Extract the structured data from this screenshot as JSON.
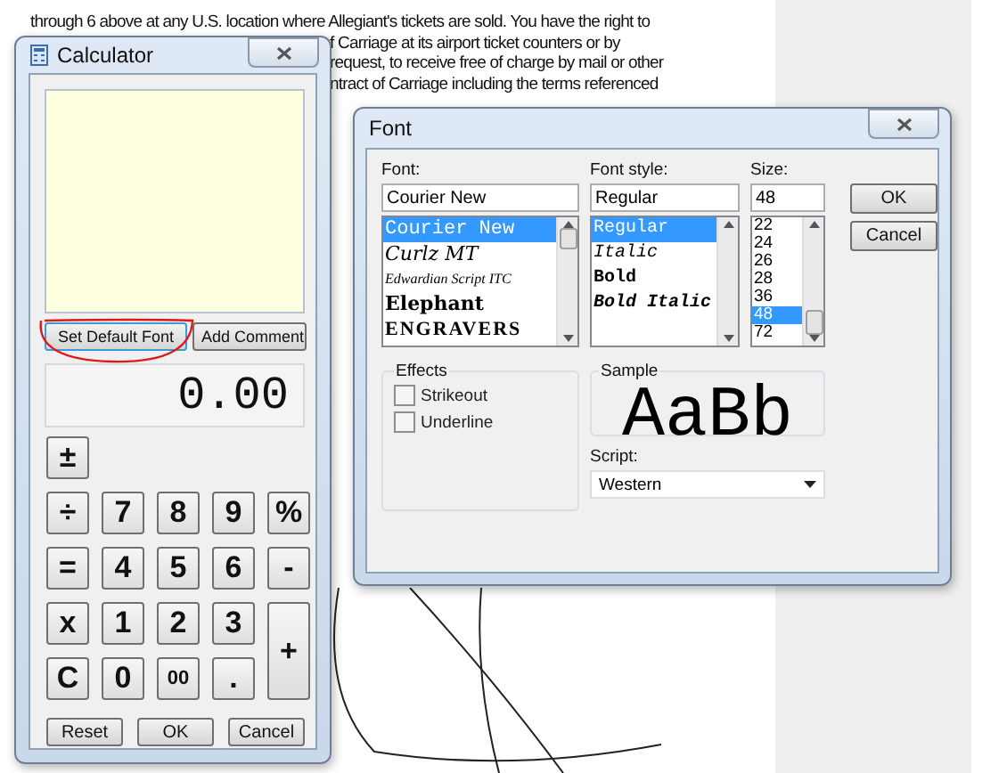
{
  "document": {
    "lines": [
      "through 6 above at any U.S. location where Allegiant's tickets are sold. You have the right to",
      "f Carriage at its airport ticket counters or by",
      "request, to receive free of charge by mail or other",
      "ntract of Carriage including the terms referenced"
    ]
  },
  "calculator": {
    "title": "Calculator",
    "note_buttons": [
      {
        "label": "Set Default Font",
        "circled": true
      },
      {
        "label": "Add Comment",
        "circled": false
      }
    ],
    "display": "0.00",
    "keys": [
      [
        {
          "label": "±",
          "kind": "normal"
        }
      ],
      [
        {
          "label": "÷",
          "kind": "normal"
        },
        {
          "label": "7",
          "kind": "normal"
        },
        {
          "label": "8",
          "kind": "normal"
        },
        {
          "label": "9",
          "kind": "normal"
        },
        {
          "label": "%",
          "kind": "normal"
        }
      ],
      [
        {
          "label": "=",
          "kind": "normal"
        },
        {
          "label": "4",
          "kind": "normal"
        },
        {
          "label": "5",
          "kind": "normal"
        },
        {
          "label": "6",
          "kind": "normal"
        },
        {
          "label": "-",
          "kind": "normal"
        }
      ],
      [
        {
          "label": "x",
          "kind": "normal"
        },
        {
          "label": "1",
          "kind": "normal"
        },
        {
          "label": "2",
          "kind": "normal"
        },
        {
          "label": "3",
          "kind": "normal"
        },
        {
          "label": "+",
          "kind": "tall"
        }
      ],
      [
        {
          "label": "C",
          "kind": "normal"
        },
        {
          "label": "0",
          "kind": "normal"
        },
        {
          "label": "00",
          "kind": "small"
        },
        {
          "label": ".",
          "kind": "normal"
        }
      ]
    ],
    "footer_buttons": [
      "Reset",
      "OK",
      "Cancel"
    ]
  },
  "font_dialog": {
    "title": "Font",
    "font": {
      "label": "Font:",
      "value": "Courier New",
      "items": [
        {
          "label": "Courier New",
          "kind": "mono",
          "selected": true
        },
        {
          "label": "Curlz MT",
          "kind": "curly",
          "selected": false
        },
        {
          "label": "Edwardian Script ITC",
          "kind": "script",
          "selected": false
        },
        {
          "label": "Elephant",
          "kind": "heavy",
          "selected": false
        },
        {
          "label": "ENGRAVERS",
          "kind": "engraved",
          "selected": false
        }
      ]
    },
    "style": {
      "label": "Font style:",
      "value": "Regular",
      "items": [
        {
          "label": "Regular",
          "kind": "regular",
          "selected": true
        },
        {
          "label": "Italic",
          "kind": "italic",
          "selected": false
        },
        {
          "label": "Bold",
          "kind": "bold",
          "selected": false
        },
        {
          "label": "Bold Italic",
          "kind": "bolditalic",
          "selected": false
        }
      ]
    },
    "size": {
      "label": "Size:",
      "value": "48",
      "items": [
        {
          "label": "22",
          "selected": false
        },
        {
          "label": "24",
          "selected": false
        },
        {
          "label": "26",
          "selected": false
        },
        {
          "label": "28",
          "selected": false
        },
        {
          "label": "36",
          "selected": false
        },
        {
          "label": "48",
          "selected": true
        },
        {
          "label": "72",
          "selected": false
        }
      ]
    },
    "buttons": [
      "OK",
      "Cancel"
    ],
    "effects": {
      "label": "Effects",
      "options": [
        {
          "label": "Strikeout",
          "checked": false
        },
        {
          "label": "Underline",
          "checked": false
        }
      ]
    },
    "sample": {
      "label": "Sample",
      "text": "AaBb"
    },
    "script": {
      "label": "Script:",
      "value": "Western"
    }
  }
}
